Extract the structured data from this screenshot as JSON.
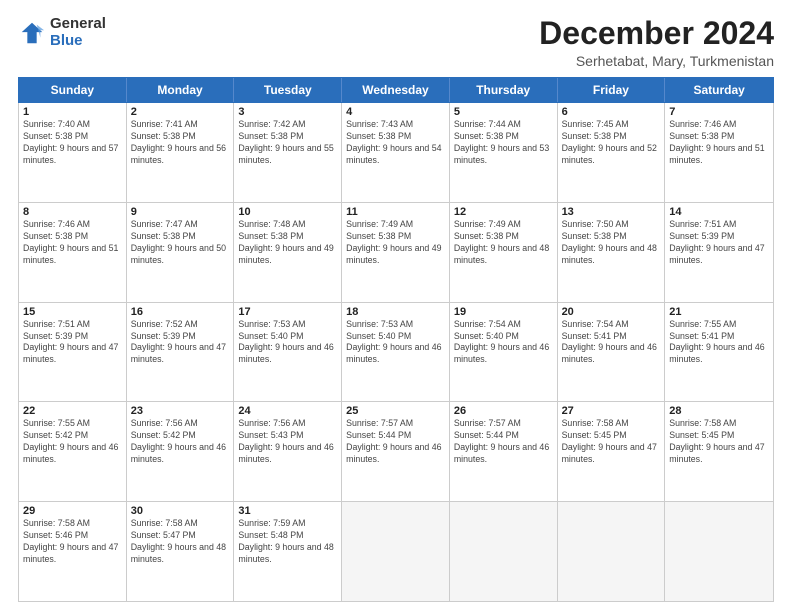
{
  "logo": {
    "general": "General",
    "blue": "Blue"
  },
  "header": {
    "month": "December 2024",
    "location": "Serhetabat, Mary, Turkmenistan"
  },
  "weekdays": [
    "Sunday",
    "Monday",
    "Tuesday",
    "Wednesday",
    "Thursday",
    "Friday",
    "Saturday"
  ],
  "rows": [
    [
      {
        "day": "1",
        "sunrise": "Sunrise: 7:40 AM",
        "sunset": "Sunset: 5:38 PM",
        "daylight": "Daylight: 9 hours and 57 minutes."
      },
      {
        "day": "2",
        "sunrise": "Sunrise: 7:41 AM",
        "sunset": "Sunset: 5:38 PM",
        "daylight": "Daylight: 9 hours and 56 minutes."
      },
      {
        "day": "3",
        "sunrise": "Sunrise: 7:42 AM",
        "sunset": "Sunset: 5:38 PM",
        "daylight": "Daylight: 9 hours and 55 minutes."
      },
      {
        "day": "4",
        "sunrise": "Sunrise: 7:43 AM",
        "sunset": "Sunset: 5:38 PM",
        "daylight": "Daylight: 9 hours and 54 minutes."
      },
      {
        "day": "5",
        "sunrise": "Sunrise: 7:44 AM",
        "sunset": "Sunset: 5:38 PM",
        "daylight": "Daylight: 9 hours and 53 minutes."
      },
      {
        "day": "6",
        "sunrise": "Sunrise: 7:45 AM",
        "sunset": "Sunset: 5:38 PM",
        "daylight": "Daylight: 9 hours and 52 minutes."
      },
      {
        "day": "7",
        "sunrise": "Sunrise: 7:46 AM",
        "sunset": "Sunset: 5:38 PM",
        "daylight": "Daylight: 9 hours and 51 minutes."
      }
    ],
    [
      {
        "day": "8",
        "sunrise": "Sunrise: 7:46 AM",
        "sunset": "Sunset: 5:38 PM",
        "daylight": "Daylight: 9 hours and 51 minutes."
      },
      {
        "day": "9",
        "sunrise": "Sunrise: 7:47 AM",
        "sunset": "Sunset: 5:38 PM",
        "daylight": "Daylight: 9 hours and 50 minutes."
      },
      {
        "day": "10",
        "sunrise": "Sunrise: 7:48 AM",
        "sunset": "Sunset: 5:38 PM",
        "daylight": "Daylight: 9 hours and 49 minutes."
      },
      {
        "day": "11",
        "sunrise": "Sunrise: 7:49 AM",
        "sunset": "Sunset: 5:38 PM",
        "daylight": "Daylight: 9 hours and 49 minutes."
      },
      {
        "day": "12",
        "sunrise": "Sunrise: 7:49 AM",
        "sunset": "Sunset: 5:38 PM",
        "daylight": "Daylight: 9 hours and 48 minutes."
      },
      {
        "day": "13",
        "sunrise": "Sunrise: 7:50 AM",
        "sunset": "Sunset: 5:38 PM",
        "daylight": "Daylight: 9 hours and 48 minutes."
      },
      {
        "day": "14",
        "sunrise": "Sunrise: 7:51 AM",
        "sunset": "Sunset: 5:39 PM",
        "daylight": "Daylight: 9 hours and 47 minutes."
      }
    ],
    [
      {
        "day": "15",
        "sunrise": "Sunrise: 7:51 AM",
        "sunset": "Sunset: 5:39 PM",
        "daylight": "Daylight: 9 hours and 47 minutes."
      },
      {
        "day": "16",
        "sunrise": "Sunrise: 7:52 AM",
        "sunset": "Sunset: 5:39 PM",
        "daylight": "Daylight: 9 hours and 47 minutes."
      },
      {
        "day": "17",
        "sunrise": "Sunrise: 7:53 AM",
        "sunset": "Sunset: 5:40 PM",
        "daylight": "Daylight: 9 hours and 46 minutes."
      },
      {
        "day": "18",
        "sunrise": "Sunrise: 7:53 AM",
        "sunset": "Sunset: 5:40 PM",
        "daylight": "Daylight: 9 hours and 46 minutes."
      },
      {
        "day": "19",
        "sunrise": "Sunrise: 7:54 AM",
        "sunset": "Sunset: 5:40 PM",
        "daylight": "Daylight: 9 hours and 46 minutes."
      },
      {
        "day": "20",
        "sunrise": "Sunrise: 7:54 AM",
        "sunset": "Sunset: 5:41 PM",
        "daylight": "Daylight: 9 hours and 46 minutes."
      },
      {
        "day": "21",
        "sunrise": "Sunrise: 7:55 AM",
        "sunset": "Sunset: 5:41 PM",
        "daylight": "Daylight: 9 hours and 46 minutes."
      }
    ],
    [
      {
        "day": "22",
        "sunrise": "Sunrise: 7:55 AM",
        "sunset": "Sunset: 5:42 PM",
        "daylight": "Daylight: 9 hours and 46 minutes."
      },
      {
        "day": "23",
        "sunrise": "Sunrise: 7:56 AM",
        "sunset": "Sunset: 5:42 PM",
        "daylight": "Daylight: 9 hours and 46 minutes."
      },
      {
        "day": "24",
        "sunrise": "Sunrise: 7:56 AM",
        "sunset": "Sunset: 5:43 PM",
        "daylight": "Daylight: 9 hours and 46 minutes."
      },
      {
        "day": "25",
        "sunrise": "Sunrise: 7:57 AM",
        "sunset": "Sunset: 5:44 PM",
        "daylight": "Daylight: 9 hours and 46 minutes."
      },
      {
        "day": "26",
        "sunrise": "Sunrise: 7:57 AM",
        "sunset": "Sunset: 5:44 PM",
        "daylight": "Daylight: 9 hours and 46 minutes."
      },
      {
        "day": "27",
        "sunrise": "Sunrise: 7:58 AM",
        "sunset": "Sunset: 5:45 PM",
        "daylight": "Daylight: 9 hours and 47 minutes."
      },
      {
        "day": "28",
        "sunrise": "Sunrise: 7:58 AM",
        "sunset": "Sunset: 5:45 PM",
        "daylight": "Daylight: 9 hours and 47 minutes."
      }
    ],
    [
      {
        "day": "29",
        "sunrise": "Sunrise: 7:58 AM",
        "sunset": "Sunset: 5:46 PM",
        "daylight": "Daylight: 9 hours and 47 minutes."
      },
      {
        "day": "30",
        "sunrise": "Sunrise: 7:58 AM",
        "sunset": "Sunset: 5:47 PM",
        "daylight": "Daylight: 9 hours and 48 minutes."
      },
      {
        "day": "31",
        "sunrise": "Sunrise: 7:59 AM",
        "sunset": "Sunset: 5:48 PM",
        "daylight": "Daylight: 9 hours and 48 minutes."
      },
      {
        "day": "",
        "sunrise": "",
        "sunset": "",
        "daylight": ""
      },
      {
        "day": "",
        "sunrise": "",
        "sunset": "",
        "daylight": ""
      },
      {
        "day": "",
        "sunrise": "",
        "sunset": "",
        "daylight": ""
      },
      {
        "day": "",
        "sunrise": "",
        "sunset": "",
        "daylight": ""
      }
    ]
  ]
}
